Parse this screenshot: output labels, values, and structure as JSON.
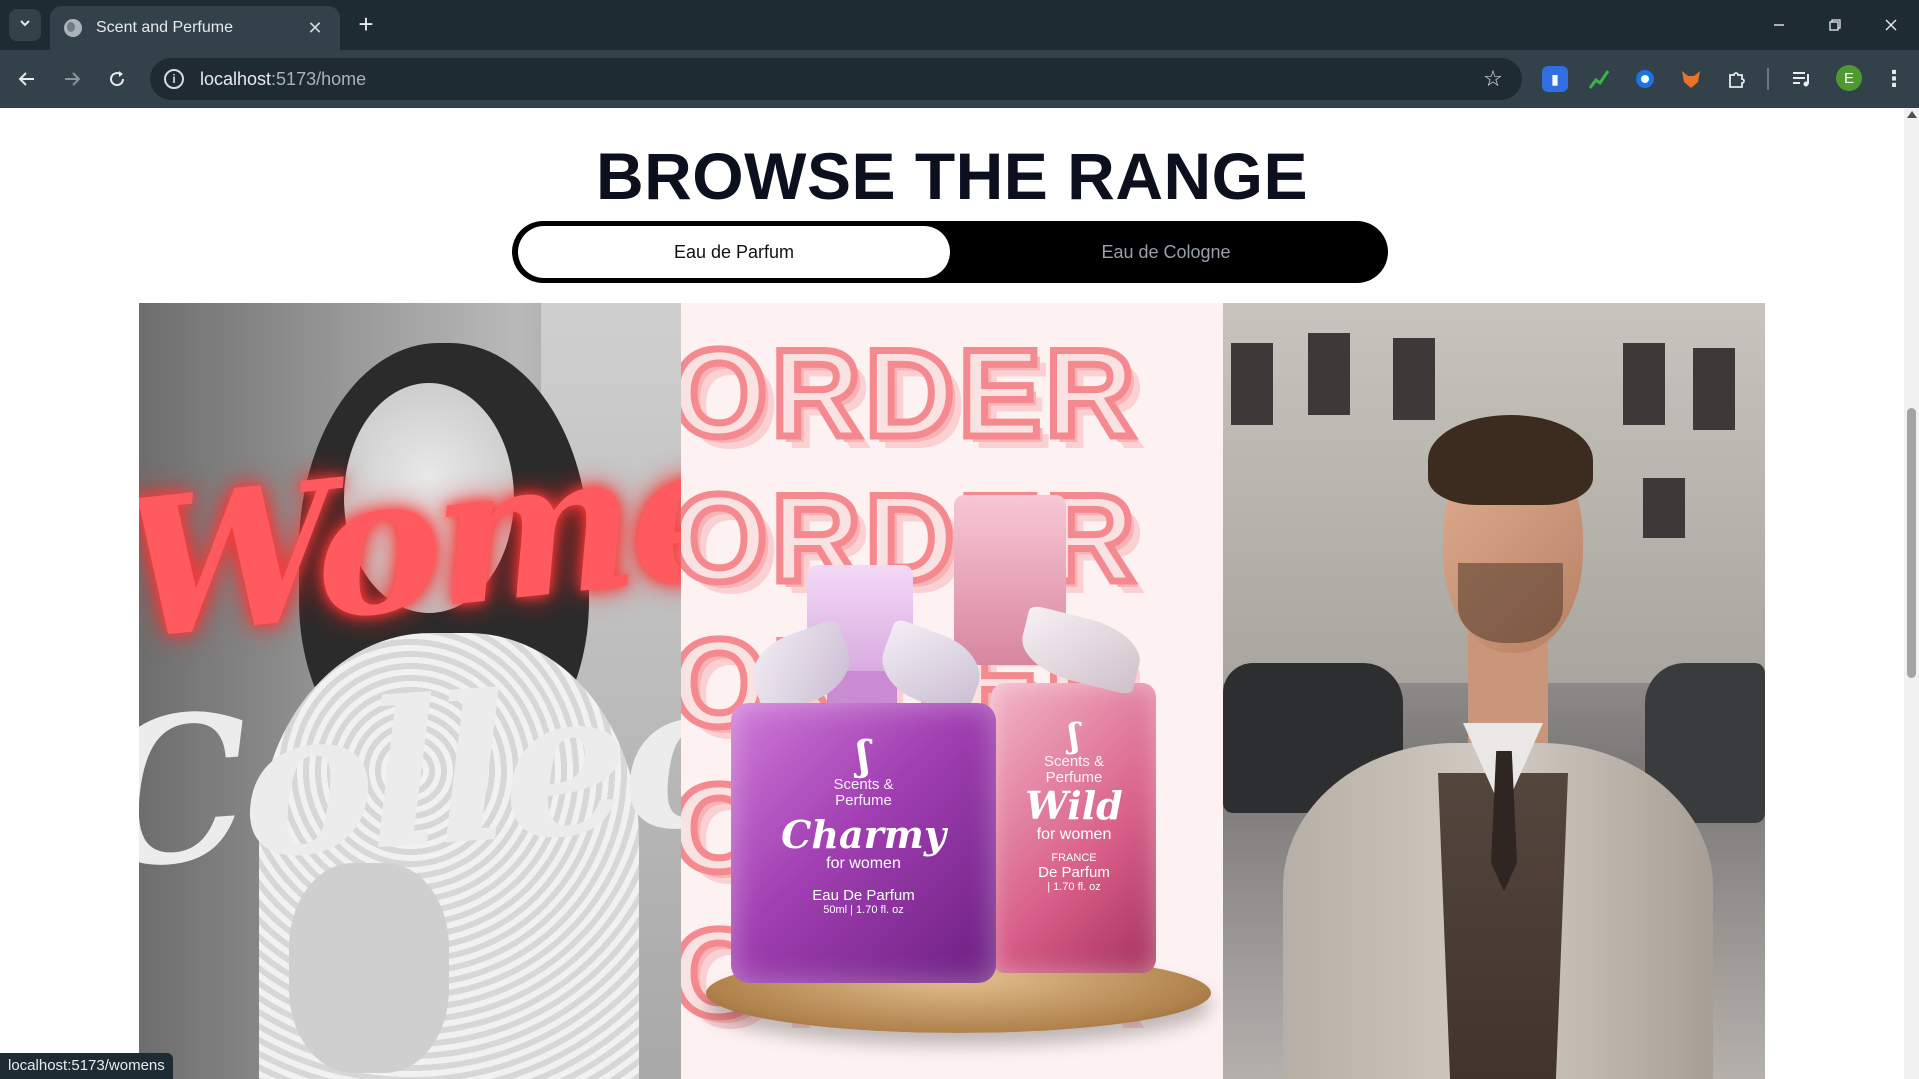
{
  "browser": {
    "tab_title": "Scent and Perfume",
    "tab_close": "✕",
    "new_tab": "+",
    "url_host": "localhost",
    "url_path": ":5173/home",
    "status_url": "localhost:5173/womens",
    "profile_initial": "E",
    "icons": {
      "tab_search": "chevron-down-icon",
      "back": "arrow-left-icon",
      "forward": "arrow-right-icon",
      "reload": "reload-icon",
      "site_info": "info-icon",
      "bookmark": "star-icon",
      "extensions": "puzzle-icon",
      "media": "media-controls-icon",
      "menu": "three-dots-icon"
    },
    "extension_colors": [
      "#2f6fe0",
      "#3db24a",
      "#1a73e8",
      "#e8742a"
    ]
  },
  "page": {
    "heading": "BROWSE THE RANGE",
    "toggle": {
      "active_label": "Eau de Parfum",
      "inactive_label": "Eau de Cologne"
    },
    "cards": {
      "women": {
        "line1": "Women's",
        "line2": "Collection"
      },
      "center": {
        "backdrop_word": "ORDER",
        "bottle1": {
          "brand_line1": "Scents &",
          "brand_line2": "Perfume",
          "name": "Charmy",
          "sub": "for women",
          "type": "Eau De Parfum",
          "volume": "50ml | 1.70 fl. oz"
        },
        "bottle2": {
          "brand_line1": "Scents &",
          "brand_line2": "Perfume",
          "name": "Wild",
          "sub": "for women",
          "origin": "FRANCE",
          "type": "De Parfum",
          "volume": "| 1.70 fl. oz"
        }
      }
    }
  },
  "colors": {
    "heading": "#0b0f1e",
    "toggle_bg": "#000000",
    "neon_text": "#ff5a5f",
    "backdrop_stroke": "#f48a8f"
  }
}
